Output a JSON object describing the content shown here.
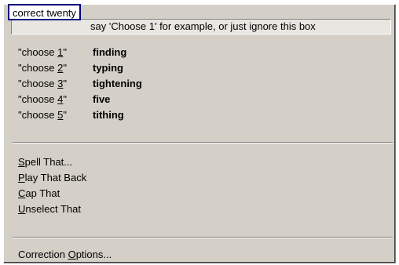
{
  "tooltip": {
    "text": "correct twenty"
  },
  "hint": {
    "text": "say 'Choose 1' for example, or just ignore this box"
  },
  "choices": [
    {
      "prefix": "\"choose ",
      "num": "1",
      "suffix": "\"",
      "word": "finding"
    },
    {
      "prefix": "\"choose ",
      "num": "2",
      "suffix": "\"",
      "word": "typing"
    },
    {
      "prefix": "\"choose ",
      "num": "3",
      "suffix": "\"",
      "word": "tightening"
    },
    {
      "prefix": "\"choose ",
      "num": "4",
      "suffix": "\"",
      "word": "five"
    },
    {
      "prefix": "\"choose ",
      "num": "5",
      "suffix": "\"",
      "word": "tithing"
    }
  ],
  "menu": {
    "spell": {
      "key": "S",
      "rest": "pell That..."
    },
    "play": {
      "key": "P",
      "rest": "lay That Back"
    },
    "cap": {
      "key": "C",
      "rest": "ap That"
    },
    "unselect": {
      "key": "U",
      "rest": "nselect That"
    },
    "options": {
      "pre": "Correction ",
      "key": "O",
      "rest": "ptions..."
    }
  }
}
